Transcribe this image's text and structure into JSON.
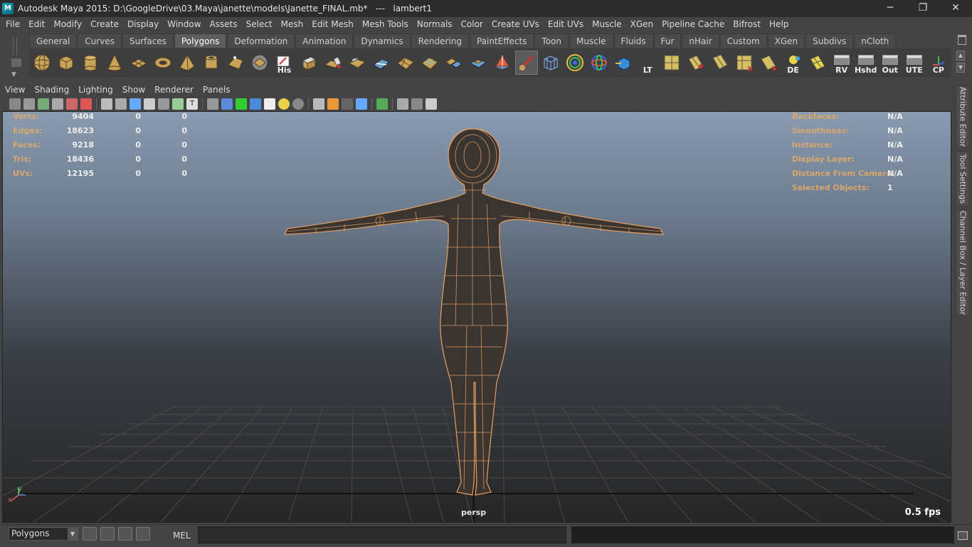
{
  "window": {
    "title": "Autodesk Maya 2015: D:\\GoogleDrive\\03.Maya\\janette\\models\\Janette_FINAL.mb*   ---   lambert1",
    "app_icon": "M",
    "minimize": "─",
    "maximize": "❐",
    "close": "✕"
  },
  "menubar": [
    "File",
    "Edit",
    "Modify",
    "Create",
    "Display",
    "Window",
    "Assets",
    "Select",
    "Mesh",
    "Edit Mesh",
    "Mesh Tools",
    "Normals",
    "Color",
    "Create UVs",
    "Edit UVs",
    "Muscle",
    "XGen",
    "Pipeline Cache",
    "Bifrost",
    "Help"
  ],
  "shelf": {
    "tabs": [
      "General",
      "Curves",
      "Surfaces",
      "Polygons",
      "Deformation",
      "Animation",
      "Dynamics",
      "Rendering",
      "PaintEffects",
      "Toon",
      "Muscle",
      "Fluids",
      "Fur",
      "nHair",
      "Custom",
      "XGen",
      "Subdivs",
      "nCloth"
    ],
    "active_tab": "Polygons",
    "text_buttons": {
      "his": "His",
      "lt": "LT",
      "de": "DE",
      "rv": "RV",
      "hshd": "Hshd",
      "out": "Out",
      "ute": "UTE",
      "cp": "CP"
    }
  },
  "panel_menu": [
    "View",
    "Shading",
    "Lighting",
    "Show",
    "Renderer",
    "Panels"
  ],
  "hud": {
    "left": [
      {
        "label": "Verts:",
        "v1": "9404",
        "v2": "0",
        "v3": "0"
      },
      {
        "label": "Edges:",
        "v1": "18623",
        "v2": "0",
        "v3": "0"
      },
      {
        "label": "Faces:",
        "v1": "9218",
        "v2": "0",
        "v3": "0"
      },
      {
        "label": "Tris:",
        "v1": "18436",
        "v2": "0",
        "v3": "0"
      },
      {
        "label": "UVs:",
        "v1": "12195",
        "v2": "0",
        "v3": "0"
      }
    ],
    "right": [
      {
        "label": "Backfaces:",
        "value": "N/A"
      },
      {
        "label": "Smoothness:",
        "value": "N/A"
      },
      {
        "label": "Instance:",
        "value": "N/A"
      },
      {
        "label": "Display Layer:",
        "value": "N/A"
      },
      {
        "label": "Distance From Camera:",
        "value": "N/A"
      },
      {
        "label": "Selected Objects:",
        "value": "1"
      }
    ],
    "camera": "persp",
    "fps": "0.5 fps",
    "axis_x": "x",
    "axis_y": "y"
  },
  "side_tabs": [
    "Attribute Editor",
    "Tool Settings",
    "Channel Box / Layer Editor"
  ],
  "cmdline": {
    "mode": "Polygons",
    "mel_label": "MEL"
  },
  "colors": {
    "hud_label": "#d7a86e",
    "wireframe": "#e8a060",
    "background_top": "#8a9bb0",
    "background_bottom": "#262626"
  }
}
